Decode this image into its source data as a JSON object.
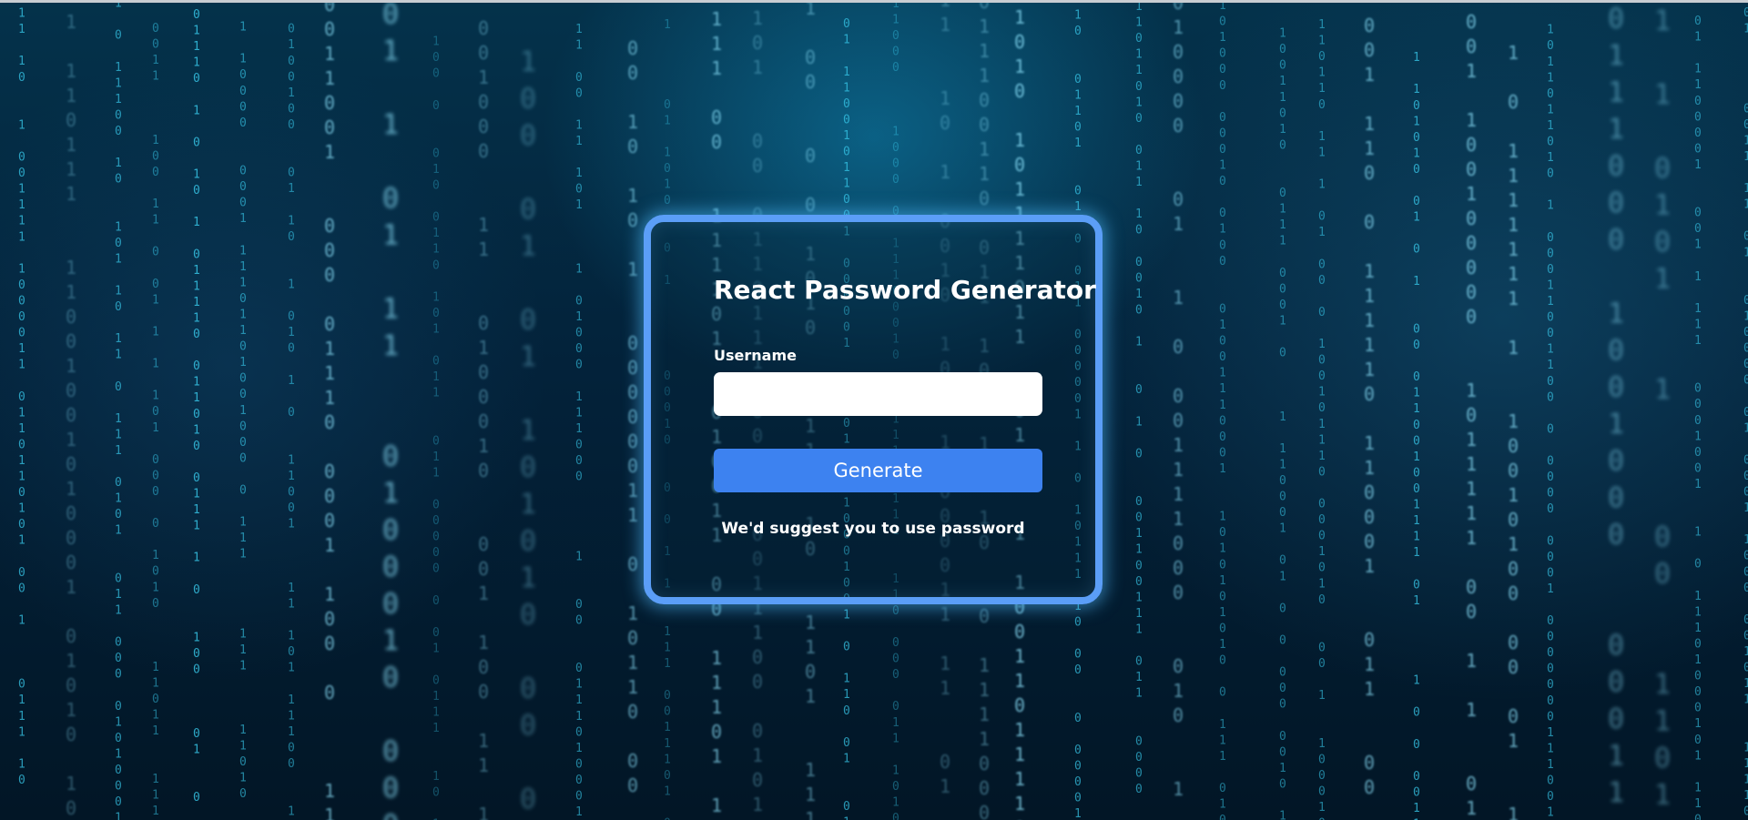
{
  "app": {
    "title": "React Password Generator"
  },
  "form": {
    "username_label": "Username",
    "username_value": "",
    "username_placeholder": "",
    "generate_label": "Generate",
    "suggestion_text": "We'd suggest you to use password"
  },
  "background": {
    "description_icon": "binary-code-rain"
  },
  "colors": {
    "card_border": "#5b9ef7",
    "button": "#3d82f0",
    "text": "#ffffff",
    "glow": "#50beff"
  }
}
